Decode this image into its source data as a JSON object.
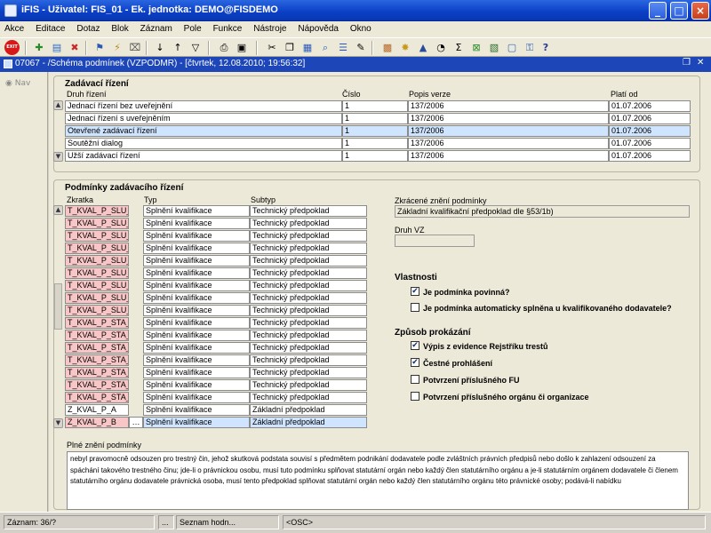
{
  "window": {
    "title": "iFIS - Uživatel: FIS_01 - Ek. jednotka: DEMO@FISDEMO"
  },
  "menu": [
    "Akce",
    "Editace",
    "Dotaz",
    "Blok",
    "Záznam",
    "Pole",
    "Funkce",
    "Nástroje",
    "Nápověda",
    "Okno"
  ],
  "toolbar": {
    "exit_label": "EXIT"
  },
  "inner": {
    "title": "07067 - /Schéma podmínek (VZPODMR) - [čtvrtek, 12.08.2010; 19:56:32]"
  },
  "nav": {
    "label": "Nav"
  },
  "zadavaci": {
    "title": "Zadávací řízení",
    "headers": {
      "druh": "Druh řízení",
      "cislo": "Číslo",
      "popis": "Popis verze",
      "platnost": "Platí od"
    },
    "rows": [
      {
        "druh": "Jednací řízení bez uveřejnění",
        "cislo": "1",
        "popis": "137/2006",
        "platnost": "01.07.2006"
      },
      {
        "druh": "Jednací řízení s uveřejněním",
        "cislo": "1",
        "popis": "137/2006",
        "platnost": "01.07.2006"
      },
      {
        "druh": "Otevřené zadávací řízení",
        "cislo": "1",
        "popis": "137/2006",
        "platnost": "01.07.2006"
      },
      {
        "druh": "Soutěžní dialog",
        "cislo": "1",
        "popis": "137/2006",
        "platnost": "01.07.2006"
      },
      {
        "druh": "Užší zadávací řízení",
        "cislo": "1",
        "popis": "137/2006",
        "platnost": "01.07.2006"
      }
    ]
  },
  "podminky": {
    "title": "Podmínky zadávacího řízení",
    "headers": {
      "zkratka": "Zkratka",
      "typ": "Typ",
      "subtyp": "Subtyp"
    },
    "rows": [
      {
        "zkratka": "T_KVAL_P_SLU_A",
        "typ": "Splnění kvalifikace",
        "subtyp": "Technický předpoklad"
      },
      {
        "zkratka": "T_KVAL_P_SLU_B",
        "typ": "Splnění kvalifikace",
        "subtyp": "Technický předpoklad"
      },
      {
        "zkratka": "T_KVAL_P_SLU_C",
        "typ": "Splnění kvalifikace",
        "subtyp": "Technický předpoklad"
      },
      {
        "zkratka": "T_KVAL_P_SLU_D",
        "typ": "Splnění kvalifikace",
        "subtyp": "Technický předpoklad"
      },
      {
        "zkratka": "T_KVAL_P_SLU_E",
        "typ": "Splnění kvalifikace",
        "subtyp": "Technický předpoklad"
      },
      {
        "zkratka": "T_KVAL_P_SLU_F",
        "typ": "Splnění kvalifikace",
        "subtyp": "Technický předpoklad"
      },
      {
        "zkratka": "T_KVAL_P_SLU_G",
        "typ": "Splnění kvalifikace",
        "subtyp": "Technický předpoklad"
      },
      {
        "zkratka": "T_KVAL_P_SLU_H",
        "typ": "Splnění kvalifikace",
        "subtyp": "Technický předpoklad"
      },
      {
        "zkratka": "T_KVAL_P_SLU_I",
        "typ": "Splnění kvalifikace",
        "subtyp": "Technický předpoklad"
      },
      {
        "zkratka": "T_KVAL_P_STA_A",
        "typ": "Splnění kvalifikace",
        "subtyp": "Technický předpoklad"
      },
      {
        "zkratka": "T_KVAL_P_STA_B",
        "typ": "Splnění kvalifikace",
        "subtyp": "Technický předpoklad"
      },
      {
        "zkratka": "T_KVAL_P_STA_C",
        "typ": "Splnění kvalifikace",
        "subtyp": "Technický předpoklad"
      },
      {
        "zkratka": "T_KVAL_P_STA_D",
        "typ": "Splnění kvalifikace",
        "subtyp": "Technický předpoklad"
      },
      {
        "zkratka": "T_KVAL_P_STA_E",
        "typ": "Splnění kvalifikace",
        "subtyp": "Technický předpoklad"
      },
      {
        "zkratka": "T_KVAL_P_STA_F",
        "typ": "Splnění kvalifikace",
        "subtyp": "Technický předpoklad"
      },
      {
        "zkratka": "T_KVAL_P_STA_G",
        "typ": "Splnění kvalifikace",
        "subtyp": "Technický předpoklad"
      },
      {
        "zkratka": "Z_KVAL_P_A",
        "typ": "Splnění kvalifikace",
        "subtyp": "Základní předpoklad"
      },
      {
        "zkratka": "Z_KVAL_P_B",
        "typ": "Splnění kvalifikace",
        "subtyp": "Základní předpoklad"
      }
    ],
    "zkracene_label": "Zkrácené znění podmínky",
    "zkracene_value": "Základní kvalifikační předpoklad dle §53/1b)",
    "druhvz_label": "Druh VZ",
    "druhvz_value": "",
    "vlastnosti_title": "Vlastnosti",
    "vlastnosti": [
      {
        "label": "Je podmínka povinná?",
        "checked": true
      },
      {
        "label": "Je podmínka automaticky splněna u kvalifikovaného dodavatele?",
        "checked": false
      }
    ],
    "zpusob_title": "Způsob prokázání",
    "zpusob": [
      {
        "label": "Výpis z evidence Rejstříku trestů",
        "checked": true
      },
      {
        "label": "Čestné prohlášení",
        "checked": true
      },
      {
        "label": "Potvrzení příslušného FU",
        "checked": false
      },
      {
        "label": "Potvrzení příslušného orgánu či organizace",
        "checked": false
      }
    ],
    "plne_label": "Plné znění podmínky",
    "plne_text": "nebyl pravomocně odsouzen pro trestný čin, jehož skutková podstata souvisí s předmětem podnikání dodavatele podle zvláštních právních předpisů nebo došlo k zahlazení odsouzení za spáchání takového trestného činu; jde-li o právnickou osobu, musí tuto podmínku splňovat statutární orgán nebo každý člen statutárního orgánu a je-li statutárním orgánem dodavatele či členem statutárního orgánu dodavatele právnická osoba, musí tento předpoklad splňovat statutární orgán nebo každý člen statutárního orgánu této právnické osoby; podává-li nabídku"
  },
  "status": {
    "record": "Záznam: 36/?",
    "dots": "...",
    "list": "Seznam hodn...",
    "osc": "<OSC>"
  }
}
